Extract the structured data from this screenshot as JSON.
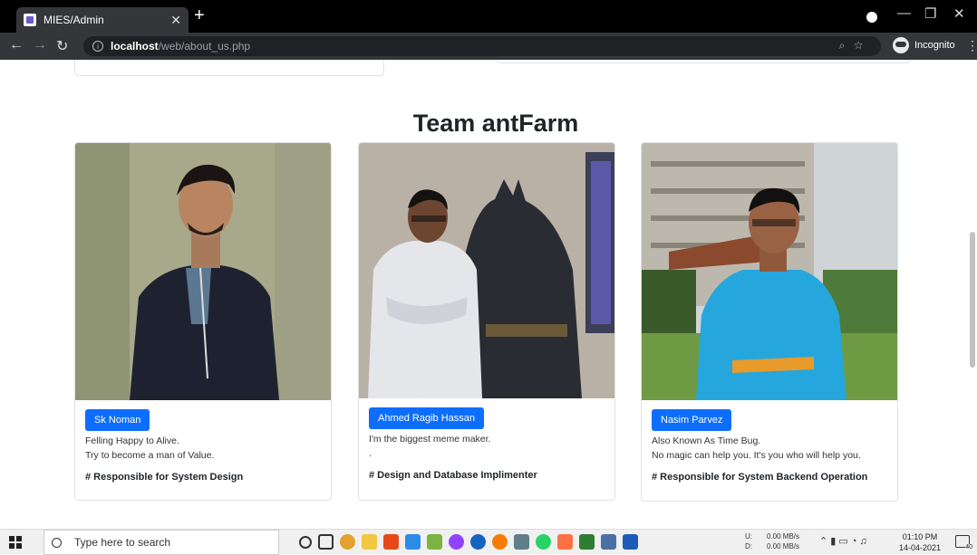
{
  "browser": {
    "tab_title": "MIES/Admin",
    "url_host": "localhost",
    "url_path": "/web/about_us.php",
    "profile_label": "Incognito"
  },
  "page": {
    "heading": "Team antFarm",
    "members": [
      {
        "name": "Sk Noman",
        "line1": "Felling Happy to Alive.",
        "line2": "Try to become a man of Value.",
        "role": "# Responsible for System Design"
      },
      {
        "name": "Ahmed Ragib Hassan",
        "line1": "I'm the biggest meme maker.",
        "line2": ".",
        "role": "# Design and Database Implimenter"
      },
      {
        "name": "Nasim Parvez",
        "line1": "Also Known As Time Bug.",
        "line2": "No magic can help you. It's you who will help you.",
        "role": "# Responsible for System Backend Operation"
      }
    ]
  },
  "taskbar": {
    "search_placeholder": "Type here to search",
    "net_up_label": "U:",
    "net_down_label": "D:",
    "net_up": "0.00 MB/s",
    "net_down": "0.00 MB/s",
    "time": "01:10 PM",
    "date": "14-04-2021",
    "notification_count": "40"
  },
  "colors": {
    "primary": "#0d6efd",
    "chrome_dark": "#35363a"
  }
}
